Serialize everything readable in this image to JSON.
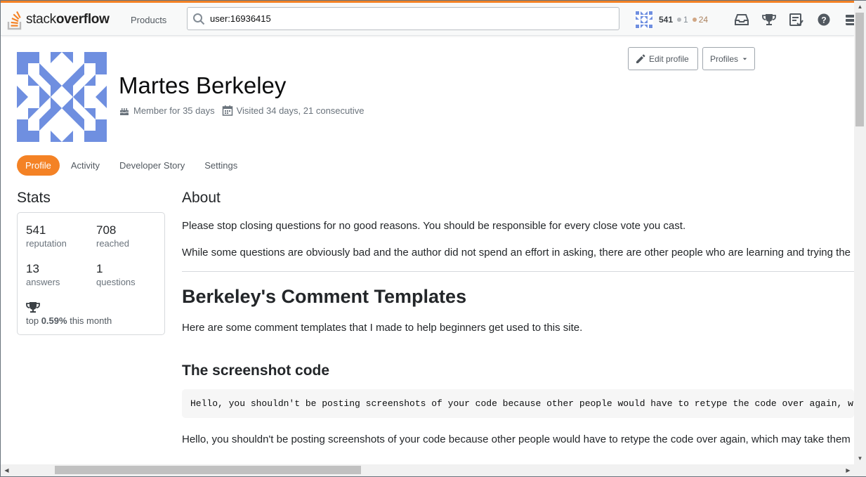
{
  "topbar": {
    "logo_plain": "stack",
    "logo_bold": "overflow",
    "products_label": "Products",
    "search_value": "user:16936415",
    "reputation": "541",
    "silver_count": "1",
    "bronze_count": "24",
    "icons": [
      "inbox-icon",
      "achievements-icon",
      "review-icon",
      "help-icon",
      "site-switcher-icon"
    ],
    "colors": {
      "accent": "#f48225",
      "silver": "#b4b8bc",
      "bronze": "#d1a684"
    }
  },
  "profile": {
    "name": "Martes Berkeley",
    "member_for": "Member for 35 days",
    "visited": "Visited 34 days, 21 consecutive",
    "edit_button": "Edit profile",
    "profiles_button": "Profiles",
    "avatar_color": "#6f8fe0"
  },
  "tabs": [
    {
      "label": "Profile",
      "active": true
    },
    {
      "label": "Activity",
      "active": false
    },
    {
      "label": "Developer Story",
      "active": false
    },
    {
      "label": "Settings",
      "active": false
    }
  ],
  "stats": {
    "title": "Stats",
    "items": [
      {
        "value": "541",
        "label": "reputation"
      },
      {
        "value": "708",
        "label": "reached"
      },
      {
        "value": "13",
        "label": "answers"
      },
      {
        "value": "1",
        "label": "questions"
      }
    ],
    "top_prefix": "top",
    "top_value": "0.59%",
    "top_suffix": "this month"
  },
  "about": {
    "title": "About",
    "paragraph1": "Please stop closing questions for no good reasons. You should be responsible for every close vote you cast.",
    "paragraph2": "While some questions are obviously bad and the author did not spend an effort in asking, there are other people who are learning and trying the",
    "heading": "Berkeley's Comment Templates",
    "intro": "Here are some comment templates that I made to help beginners get used to this site.",
    "subheading": "The screenshot code",
    "code": "Hello, you shouldn't be posting screenshots of your code because other people would have to retype the code over again, whic",
    "paragraph3": "Hello, you shouldn't be posting screenshots of your code because other people would have to retype the code over again, which may take them"
  }
}
